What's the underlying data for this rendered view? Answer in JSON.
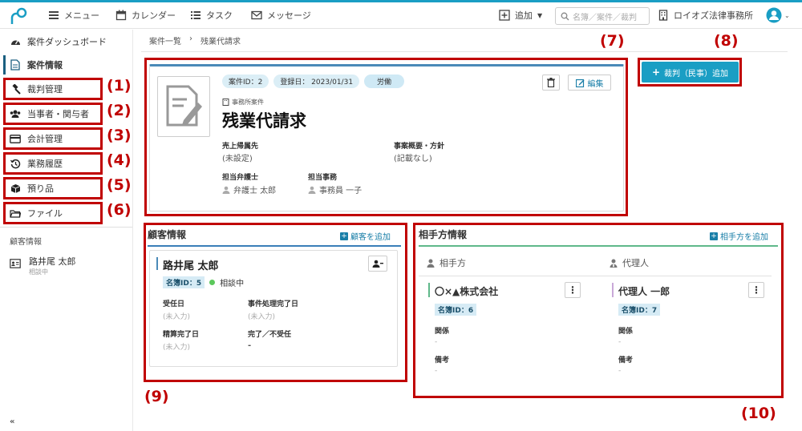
{
  "topbar": {
    "menu_label": "メニュー",
    "calendar_label": "カレンダー",
    "task_label": "タスク",
    "message_label": "メッセージ",
    "add_label": "追加",
    "search_placeholder": "名簿／案件／裁判",
    "office_name": "ロイオズ法律事務所"
  },
  "sidebar": {
    "items": [
      {
        "label": "案件ダッシュボード",
        "icon": "dashboard-icon"
      },
      {
        "label": "案件情報",
        "icon": "document-icon"
      },
      {
        "label": "裁判管理",
        "icon": "gavel-icon"
      },
      {
        "label": "当事者・関与者",
        "icon": "users-icon"
      },
      {
        "label": "会計管理",
        "icon": "credit-card-icon"
      },
      {
        "label": "業務履歴",
        "icon": "history-icon"
      },
      {
        "label": "預り品",
        "icon": "box-icon"
      },
      {
        "label": "ファイル",
        "icon": "folder-icon"
      }
    ],
    "client_section_title": "顧客情報",
    "client_name": "路井尾 太郎",
    "client_status": "相談中"
  },
  "breadcrumb": {
    "parent": "案件一覧",
    "separator": "›",
    "current": "残業代請求"
  },
  "annotations": [
    "(1)",
    "(2)",
    "(3)",
    "(4)",
    "(5)",
    "(6)",
    "(7)",
    "(8)",
    "(9)",
    "(10)"
  ],
  "case": {
    "case_id": "案件ID：2",
    "registered": "登録日： 2023/01/31",
    "category": "労働",
    "office_case_label": "事務所案件",
    "title": "残業代請求",
    "edit_label": "編集",
    "revenue_label": "売上帰属先",
    "revenue_value": "(未設定)",
    "summary_label": "事案概要・方針",
    "summary_value": "(記載なし)",
    "lawyer_label": "担当弁護士",
    "lawyer_value": "弁護士 太郎",
    "staff_label": "担当事務",
    "staff_value": "事務員 一子"
  },
  "add_trial_button": "裁判（民事）追加",
  "client_info": {
    "title": "顧客情報",
    "add_label": "顧客を追加",
    "name": "路井尾 太郎",
    "registry_id": "名簿ID：5",
    "status": "相談中",
    "fields": [
      {
        "label": "受任日",
        "value": "(未入力)"
      },
      {
        "label": "事件処理完了日",
        "value": "(未入力)"
      },
      {
        "label": "精算完了日",
        "value": "(未入力)"
      },
      {
        "label": "完了／不受任",
        "value": "-"
      }
    ]
  },
  "opponent_info": {
    "title": "相手方情報",
    "add_label": "相手方を追加",
    "col_opponent": "相手方",
    "col_agent": "代理人",
    "opponent": {
      "name": "〇×▲株式会社",
      "registry_id": "名簿ID：6",
      "relation_label": "関係",
      "relation_value": "-",
      "note_label": "備考",
      "note_value": "-"
    },
    "agent": {
      "name": "代理人 一郎",
      "registry_id": "名簿ID：7",
      "relation_label": "関係",
      "relation_value": "-",
      "note_label": "備考",
      "note_value": "-"
    }
  },
  "colors": {
    "accent": "#1a9ec4",
    "annotation_red": "#c00000",
    "button_teal": "#1a9ec4"
  }
}
